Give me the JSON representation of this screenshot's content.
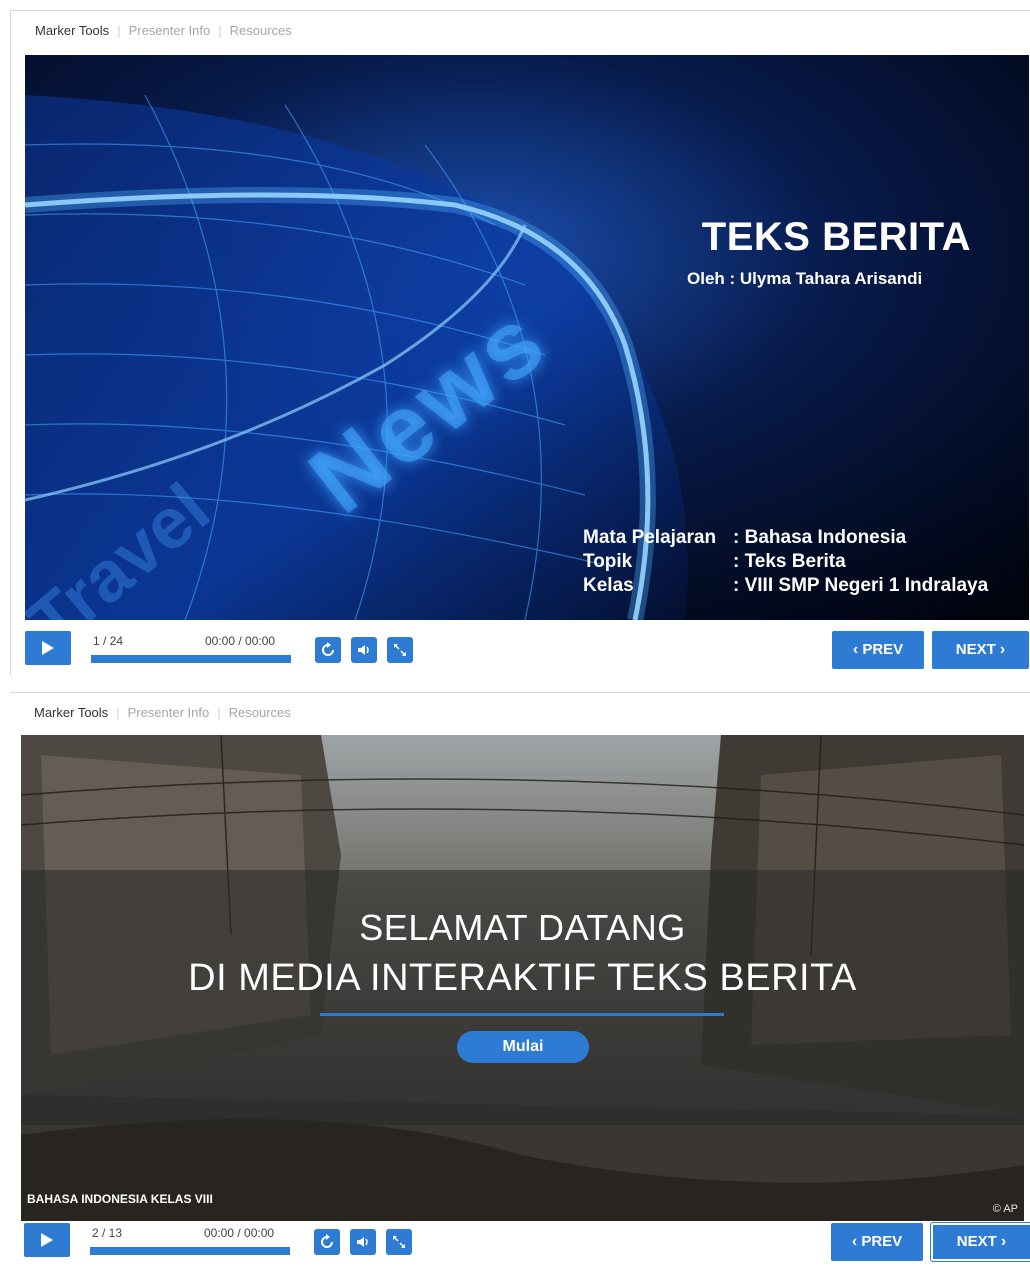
{
  "players": [
    {
      "tabs": [
        "Marker Tools",
        "Presenter Info",
        "Resources"
      ],
      "counter": "1 / 24",
      "time": "00:00 / 00:00",
      "progress": 1.0,
      "prev_label": "PREV",
      "next_label": "NEXT",
      "slide": {
        "title": "TEKS BERITA",
        "author": "Oleh : Ulyma Tahara Arisandi",
        "info": [
          {
            "key": "Mata Pelajaran",
            "value": ": Bahasa Indonesia"
          },
          {
            "key": "Topik",
            "value": ": Teks Berita"
          },
          {
            "key": "Kelas",
            "value": ": VIII SMP Negeri 1 Indralaya"
          }
        ],
        "background_words": [
          "News",
          "Travel"
        ]
      }
    },
    {
      "tabs": [
        "Marker Tools",
        "Presenter Info",
        "Resources"
      ],
      "counter": "2 / 13",
      "time": "00:00 / 00:00",
      "progress": 1.0,
      "prev_label": "PREV",
      "next_label": "NEXT",
      "slide": {
        "line1": "SELAMAT DATANG",
        "line2": "DI MEDIA INTERAKTIF TEKS BERITA",
        "button": "Mulai",
        "footer": "BAHASA INDONESIA KELAS VIII",
        "credit": "© AP"
      }
    }
  ],
  "colors": {
    "accent": "#2e7bd3",
    "tab_active": "#333333",
    "tab_inactive": "#a6a6a6"
  },
  "icons": [
    "play-icon",
    "replay-icon",
    "volume-icon",
    "fullscreen-icon",
    "chevron-left-icon",
    "chevron-right-icon"
  ]
}
